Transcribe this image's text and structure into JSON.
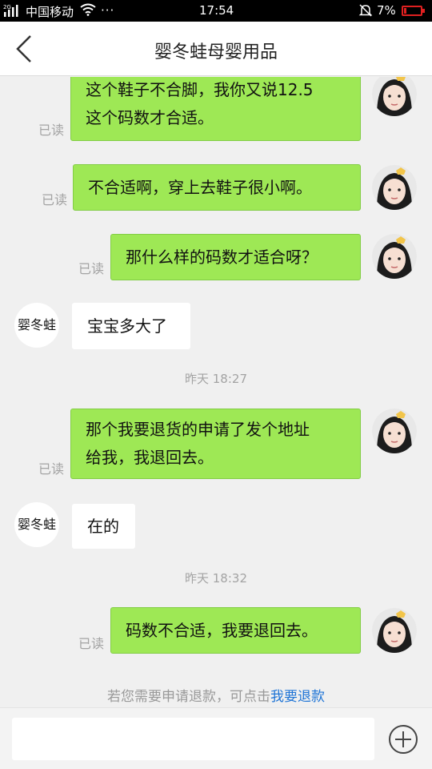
{
  "status_bar": {
    "signal": "2G",
    "carrier": "中国移动",
    "dots": "···",
    "time": "17:54",
    "battery": "7%"
  },
  "header": {
    "title": "婴冬蛙母婴用品"
  },
  "messages": [
    {
      "side": "right",
      "lines": [
        "这个鞋子不合脚，我你又说12.5",
        "这个码数才合适。"
      ],
      "read": "已读"
    },
    {
      "side": "right",
      "lines": [
        "不合适啊，穿上去鞋子很小啊。"
      ],
      "read": "已读"
    },
    {
      "side": "right",
      "lines": [
        "那什么样的码数才适合呀？"
      ],
      "read": "已读"
    },
    {
      "side": "left",
      "name": "婴冬蛙",
      "lines": [
        "宝宝多大了"
      ]
    },
    {
      "type": "time",
      "text": "昨天 18:27"
    },
    {
      "side": "right",
      "lines": [
        "那个我要退货的申请了发个地址",
        "给我，我退回去。"
      ],
      "read": "已读"
    },
    {
      "side": "left",
      "name": "婴冬蛙",
      "lines": [
        "在的"
      ]
    },
    {
      "type": "time",
      "text": "昨天 18:32"
    },
    {
      "side": "right",
      "lines": [
        "码数不合适，我要退回去。"
      ],
      "read": "已读"
    }
  ],
  "refund": {
    "prefix": "若您需要申请退款，可点击",
    "link": "我要退款"
  },
  "input": {
    "placeholder": ""
  },
  "icons": {
    "back": "back-arrow-icon",
    "plus": "plus-circle-icon",
    "bell": "bell-muted-icon",
    "wifi": "wifi-icon"
  },
  "colors": {
    "bubble_right": "#9ee855",
    "bubble_left": "#ffffff",
    "link": "#1e74d6",
    "battery": "#e02020"
  }
}
